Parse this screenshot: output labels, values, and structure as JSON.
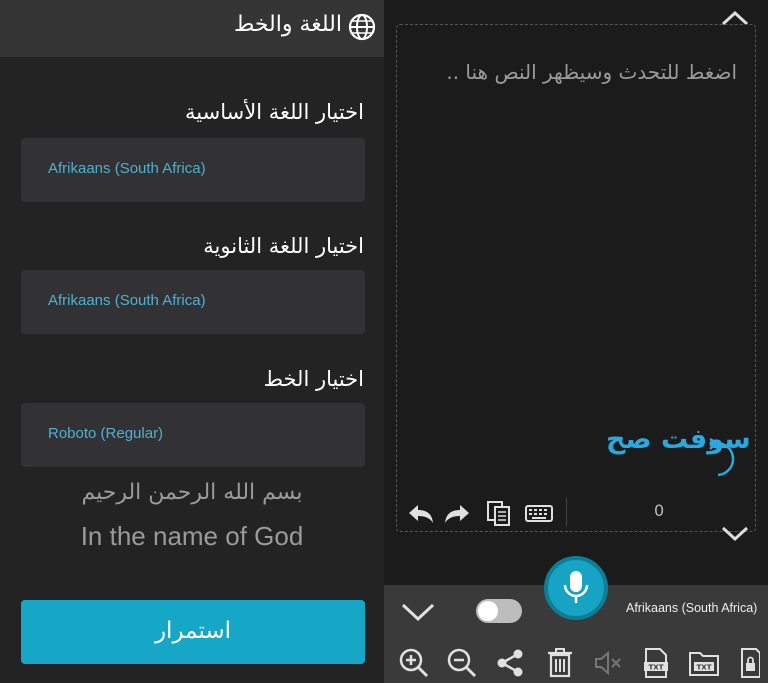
{
  "settings": {
    "title": "اللغة والخط",
    "primary_label": "اختيار اللغة الأساسية",
    "primary_value": "Afrikaans (South Africa)",
    "secondary_label": "اختيار اللغة الثانوية",
    "secondary_value": "Afrikaans (South Africa)",
    "font_label": "اختيار الخط",
    "font_value": "Roboto (Regular)",
    "preview_ar": "بسم الله الرحمن الرحيم",
    "preview_en": "In the name of God",
    "continue_label": "استمرار"
  },
  "editor": {
    "placeholder": "اضغط للتحدث وسيظهر النص هنا ..",
    "logo": "سوفت صح",
    "word_count": "0",
    "language": "Afrikaans (South Africa)"
  },
  "colors": {
    "accent": "#16a6c6",
    "select_text": "#4fb0cf",
    "logo": "#2aa8e0"
  },
  "icons": [
    "globe-icon",
    "chevron-up-icon",
    "chevron-down-icon",
    "undo-icon",
    "redo-icon",
    "copy-icon",
    "keyboard-icon",
    "microphone-icon",
    "zoom-in-icon",
    "zoom-out-icon",
    "share-icon",
    "trash-icon",
    "mute-icon",
    "txt-file-icon",
    "txt-folder-icon",
    "lock-file-icon"
  ]
}
